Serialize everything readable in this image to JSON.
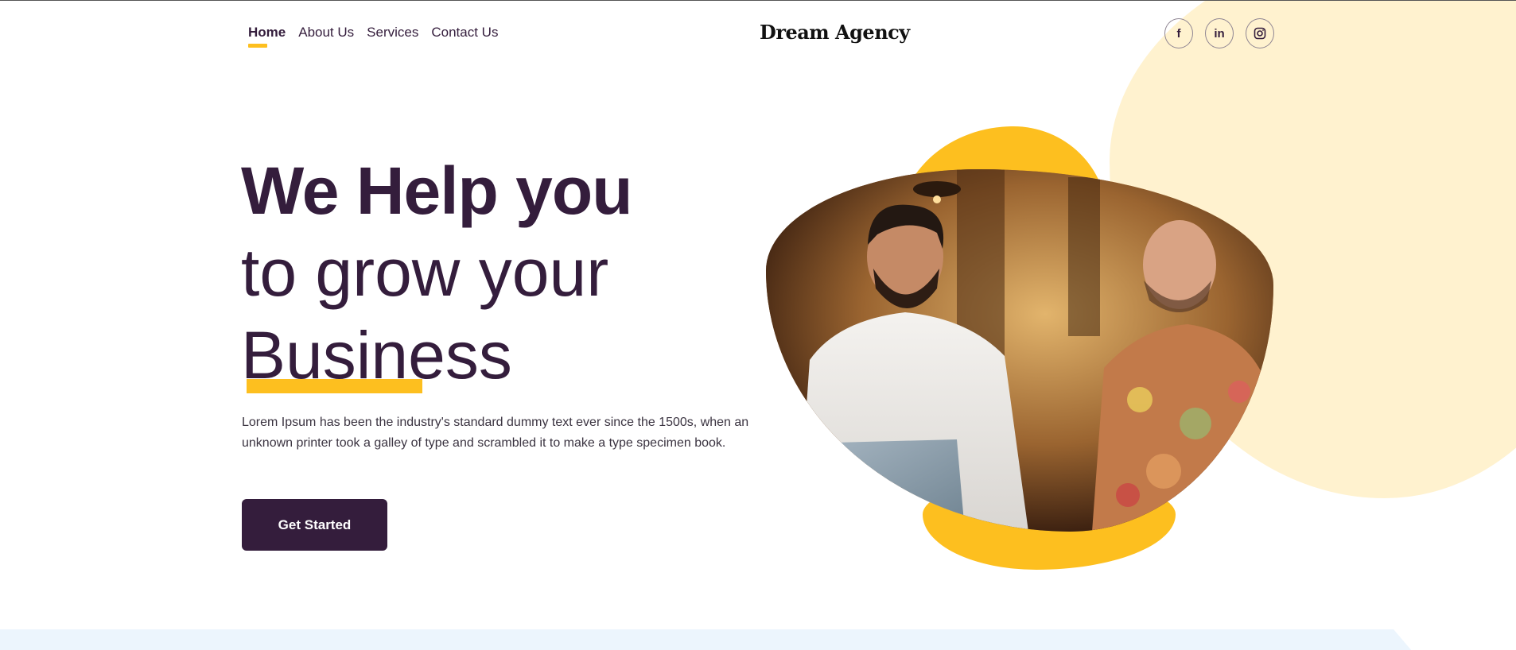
{
  "colors": {
    "primary": "#341d3c",
    "accent_yellow": "#fdbf1f",
    "cream": "#fff2cf",
    "light_blue": "#ecf5fd"
  },
  "nav": {
    "items": [
      {
        "label": "Home",
        "active": true
      },
      {
        "label": "About Us",
        "active": false
      },
      {
        "label": "Services",
        "active": false
      },
      {
        "label": "Contact Us",
        "active": false
      }
    ]
  },
  "brand": {
    "logo": "Dream Agency"
  },
  "social": [
    {
      "icon": "facebook-icon",
      "glyph": "f"
    },
    {
      "icon": "linkedin-icon",
      "glyph": "in"
    },
    {
      "icon": "instagram-icon",
      "glyph": "◎"
    }
  ],
  "hero": {
    "line1": "We Help you",
    "line2": "to grow your",
    "line3": "Business",
    "description": "Lorem Ipsum has been the industry's standard dummy text ever since the 1500s, when an unknown printer took a galley of type and scrambled it to make a type specimen book.",
    "cta_label": "Get Started",
    "image_icon": "team-meeting-photo"
  }
}
